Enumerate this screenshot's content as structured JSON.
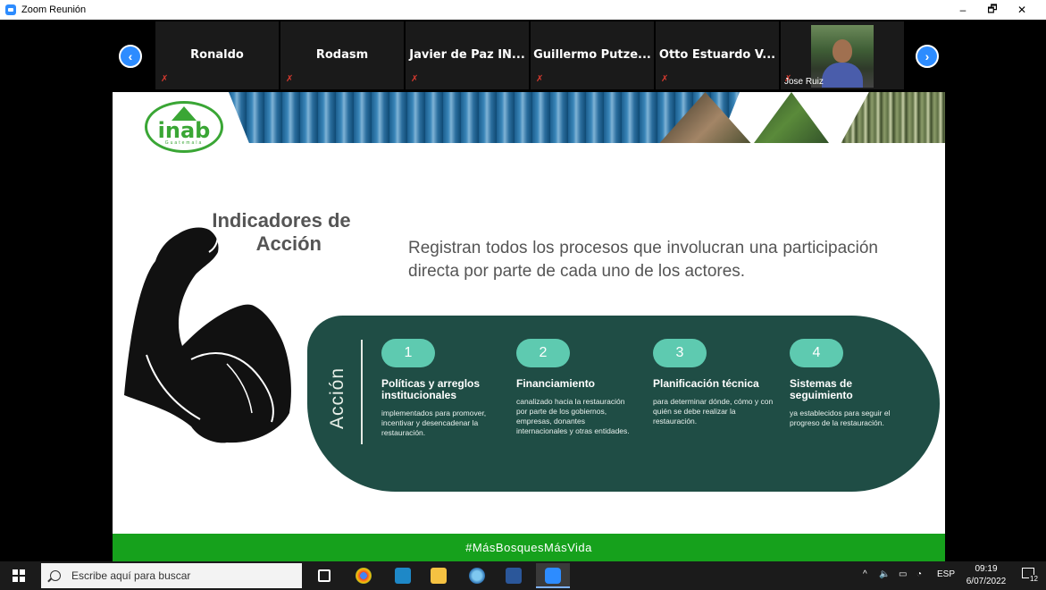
{
  "window": {
    "title": "Zoom Reunión",
    "minimize": "–",
    "restore": "🗗",
    "close": "✕"
  },
  "participants": {
    "prev_icon": "chevron-left-icon",
    "next_icon": "chevron-right-icon",
    "tiles": [
      {
        "name": "Ronaldo",
        "muted": true
      },
      {
        "name": "Rodasm",
        "muted": true
      },
      {
        "name": "Javier de Paz IN...",
        "muted": true
      },
      {
        "name": "Guillermo  Putze...",
        "muted": true
      },
      {
        "name": "Otto Estuardo V...",
        "muted": true
      }
    ],
    "video": {
      "name": "Jose Ruiz",
      "muted": true
    }
  },
  "slide": {
    "logo": {
      "text": "inab",
      "sub": "Guatemala"
    },
    "heading_line1": "Indicadores de",
    "heading_line2": "Acción",
    "description": "Registran todos los procesos que involucran una participación directa por parte de cada uno de los actores.",
    "panel_label": "Acción",
    "steps": [
      {
        "number": "1",
        "title": "Políticas y arreglos institucionales",
        "desc": "implementados para promover, incentivar y desencadenar la restauración."
      },
      {
        "number": "2",
        "title": "Financiamiento",
        "desc": "canalizado hacia la restauración por parte de los gobiernos, empresas, donantes internacionales y otras entidades."
      },
      {
        "number": "3",
        "title": "Planificación técnica",
        "desc": "para determinar dónde, cómo y con quién se debe realizar la restauración."
      },
      {
        "number": "4",
        "title": "Sistemas de seguimiento",
        "desc": "ya establecidos para seguir el progreso de la restauración."
      }
    ],
    "footer": "#MásBosquesMásVida"
  },
  "taskbar": {
    "search_placeholder": "Escribe aquí para buscar",
    "language": "ESP",
    "time": "09:19",
    "date": "6/07/2022",
    "notification_count": "12"
  },
  "colors": {
    "panel": "#1f4d45",
    "badge": "#5ecab0",
    "footer": "#16a11c",
    "zoom_blue": "#2d8cff"
  }
}
